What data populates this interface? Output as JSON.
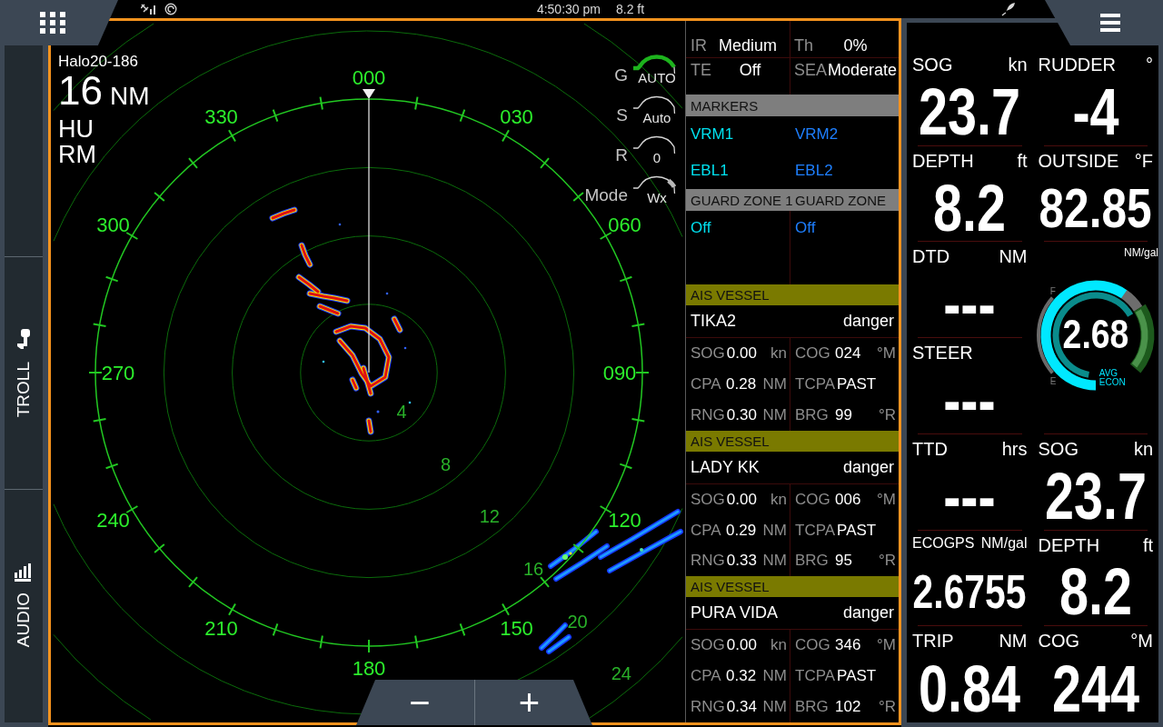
{
  "top_bar": {
    "time": "4:50:30 pm",
    "depth": "8.2 ft"
  },
  "sidebar": {
    "items": [
      {
        "label": "TROLL",
        "kind": "troll"
      },
      {
        "label": "AUDIO",
        "kind": "audio"
      }
    ]
  },
  "radar": {
    "source": "Halo20-186",
    "range": "16",
    "range_unit": "NM",
    "orientation": "HU",
    "motion": "RM",
    "controls": [
      {
        "label": "G",
        "value": "AUTO",
        "kind": "gain",
        "level": 1
      },
      {
        "label": "S",
        "value": "Auto",
        "kind": "plain"
      },
      {
        "label": "R",
        "value": "0",
        "kind": "plain"
      },
      {
        "label": "Mode",
        "value": "Wx",
        "kind": "mode",
        "level": 0.9
      }
    ],
    "bearing_labels": [
      "000",
      "330",
      "030",
      "300",
      "060",
      "270",
      "090",
      "240",
      "120",
      "210",
      "150",
      "180"
    ],
    "ring_labels": [
      "4",
      "8",
      "12",
      "16",
      "20",
      "24"
    ],
    "zoom_buttons": [
      "−",
      "+"
    ]
  },
  "info_panel": {
    "settings": [
      {
        "label": "IR",
        "value": "Medium"
      },
      {
        "label": "Th",
        "value": "0%"
      },
      {
        "label": "TE",
        "value": "Off"
      },
      {
        "label": "SEA",
        "value": "Moderate"
      }
    ],
    "markers": {
      "title": "MARKERS",
      "items": [
        {
          "label": "VRM1",
          "color": "#00e1f0"
        },
        {
          "label": "VRM2",
          "color": "#1e7fff"
        },
        {
          "label": "EBL1",
          "color": "#00e1f0"
        },
        {
          "label": "EBL2",
          "color": "#1e7fff"
        }
      ]
    },
    "guard_zones": [
      {
        "title": "GUARD ZONE 1",
        "value": "Off",
        "color": "#00e1f0"
      },
      {
        "title": "GUARD ZONE",
        "value": "Off",
        "color": "#1e7fff"
      }
    ],
    "ais_vessels": [
      {
        "title": "AIS VESSEL",
        "name": "TIKA2",
        "status": "danger",
        "fields": [
          {
            "label": "SOG",
            "value": "0.00",
            "unit": "kn"
          },
          {
            "label": "COG",
            "value": "024",
            "unit": "°M"
          },
          {
            "label": "CPA",
            "value": "0.28",
            "unit": "NM"
          },
          {
            "label": "TCPA",
            "value": "PAST"
          },
          {
            "label": "RNG",
            "value": "0.30",
            "unit": "NM"
          },
          {
            "label": "BRG",
            "value": "99",
            "unit": "°R"
          }
        ]
      },
      {
        "title": "AIS VESSEL",
        "name": "LADY KK",
        "status": "danger",
        "fields": [
          {
            "label": "SOG",
            "value": "0.00",
            "unit": "kn"
          },
          {
            "label": "COG",
            "value": "006",
            "unit": "°M"
          },
          {
            "label": "CPA",
            "value": "0.29",
            "unit": "NM"
          },
          {
            "label": "TCPA",
            "value": "PAST"
          },
          {
            "label": "RNG",
            "value": "0.33",
            "unit": "NM"
          },
          {
            "label": "BRG",
            "value": "95",
            "unit": "°R"
          }
        ]
      },
      {
        "title": "AIS VESSEL",
        "name": "PURA VIDA",
        "status": "danger",
        "fields": [
          {
            "label": "SOG",
            "value": "0.00",
            "unit": "kn"
          },
          {
            "label": "COG",
            "value": "346",
            "unit": "°M"
          },
          {
            "label": "CPA",
            "value": "0.32",
            "unit": "NM"
          },
          {
            "label": "TCPA",
            "value": "PAST"
          },
          {
            "label": "RNG",
            "value": "0.34",
            "unit": "NM"
          },
          {
            "label": "BRG",
            "value": "102",
            "unit": "°R"
          }
        ]
      }
    ]
  },
  "data_panel": {
    "columns": [
      [
        {
          "kind": "readout",
          "label": "SOG",
          "unit": "kn",
          "value": "23.7"
        },
        {
          "kind": "readout",
          "label": "DEPTH",
          "unit": "ft",
          "value": "8.2"
        },
        {
          "kind": "readout",
          "label": "DTD",
          "unit": "NM",
          "value": "---"
        },
        {
          "kind": "readout",
          "label": "STEER",
          "value": "---"
        },
        {
          "kind": "readout",
          "label": "TTD",
          "unit": "hrs",
          "value": "---"
        },
        {
          "kind": "readout",
          "label": "ECOGPS",
          "unit": "NM/gal",
          "value": "2.6755"
        },
        {
          "kind": "readout",
          "label": "TRIP",
          "unit": "NM",
          "value": "0.84"
        }
      ],
      [
        {
          "kind": "readout",
          "label": "RUDDER",
          "unit": "°",
          "value": "-4"
        },
        {
          "kind": "readout",
          "label": "OUTSIDE",
          "unit": "°F",
          "value": "82.85"
        },
        {
          "kind": "gauge",
          "unit": "NM/gal",
          "value": "2.68",
          "caption": "AVG ECON",
          "scale_top": "F",
          "scale_bottom": "E"
        },
        {
          "kind": "readout",
          "label": "SOG",
          "unit": "kn",
          "value": "23.7"
        },
        {
          "kind": "readout",
          "label": "DEPTH",
          "unit": "ft",
          "value": "8.2"
        },
        {
          "kind": "readout",
          "label": "COG",
          "unit": "°M",
          "value": "244"
        }
      ]
    ]
  }
}
